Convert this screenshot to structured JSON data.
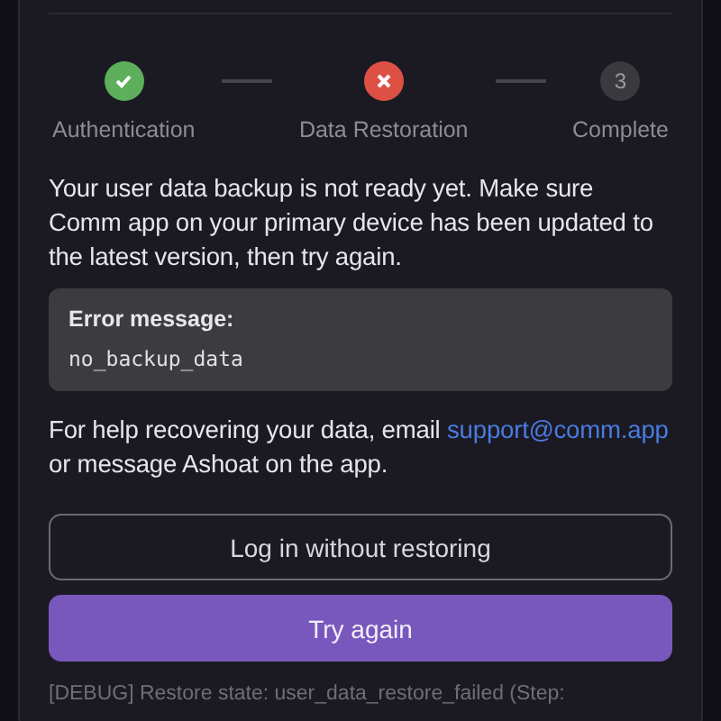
{
  "steps": [
    {
      "label": "Authentication",
      "kind": "done"
    },
    {
      "label": "Data Restoration",
      "kind": "failed"
    },
    {
      "label": "Complete",
      "kind": "pending",
      "number": "3"
    }
  ],
  "message": "Your user data backup is not ready yet. Make sure Comm app on your primary device has been updated to the latest version, then try again.",
  "error": {
    "title": "Error message:",
    "code": "no_backup_data"
  },
  "help": {
    "before": "For help recovering your data, email",
    "link": "support@comm.app",
    "after": "or message Ashoat on the app."
  },
  "buttons": [
    {
      "label": "Log in without restoring",
      "kind": "outline"
    },
    {
      "label": "Try again",
      "kind": "primary"
    }
  ],
  "debug": "[DEBUG] Restore state: user_data_restore_failed (Step:"
}
